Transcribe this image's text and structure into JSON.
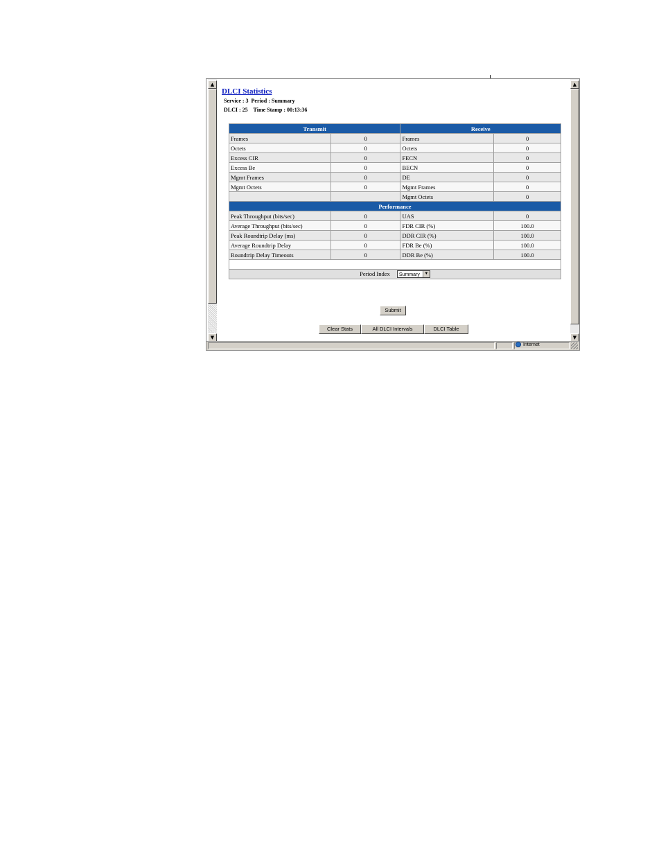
{
  "page": {
    "title": "DLCI Statistics",
    "service_line": "Service : 3  Period : Summary",
    "dlci_line": "DLCI : 25    Time Stamp : 00:13:36"
  },
  "table": {
    "transmit_header": "Transmit",
    "receive_header": "Receive",
    "performance_header": "Performance",
    "counter_rows": [
      {
        "tx_label": "Frames",
        "tx_value": "0",
        "rx_label": "Frames",
        "rx_value": "0"
      },
      {
        "tx_label": "Octets",
        "tx_value": "0",
        "rx_label": "Octets",
        "rx_value": "0"
      },
      {
        "tx_label": "Excess CIR",
        "tx_value": "0",
        "rx_label": "FECN",
        "rx_value": "0"
      },
      {
        "tx_label": "Excess Be",
        "tx_value": "0",
        "rx_label": "BECN",
        "rx_value": "0"
      },
      {
        "tx_label": "Mgmt Frames",
        "tx_value": "0",
        "rx_label": "DE",
        "rx_value": "0"
      },
      {
        "tx_label": "Mgmt Octets",
        "tx_value": "0",
        "rx_label": "Mgmt Frames",
        "rx_value": "0"
      },
      {
        "tx_label": "",
        "tx_value": "",
        "rx_label": "Mgmt Octets",
        "rx_value": "0"
      }
    ],
    "performance_rows": [
      {
        "tx_label": "Peak Throughput (bits/sec)",
        "tx_value": "0",
        "rx_label": "UAS",
        "rx_value": "0"
      },
      {
        "tx_label": "Average Throughput (bits/sec)",
        "tx_value": "0",
        "rx_label": "FDR CIR (%)",
        "rx_value": "100.0"
      },
      {
        "tx_label": "Peak Roundtrip  Delay (ms)",
        "tx_value": "0",
        "rx_label": "DDR CIR (%)",
        "rx_value": "100.0"
      },
      {
        "tx_label": "Average Roundtrip Delay",
        "tx_value": "0",
        "rx_label": "FDR Be (%)",
        "rx_value": "100.0"
      },
      {
        "tx_label": "Roundtrip Delay Timeouts",
        "tx_value": "0",
        "rx_label": "DDR Be (%)",
        "rx_value": "100.0"
      }
    ],
    "period_index_label": "Period Index",
    "period_index_value": "Summary"
  },
  "buttons": {
    "submit": "Submit",
    "clear_stats": "Clear Stats",
    "all_intervals": "All DLCI Intervals",
    "dlci_table": "DLCI Table"
  },
  "status": {
    "zone": "Internet"
  },
  "icons": {
    "scroll_up": "scroll-up-icon",
    "scroll_down": "scroll-down-icon",
    "dropdown": "chevron-down-icon",
    "zone": "globe-icon"
  },
  "colors": {
    "header_bg": "#1a5aa6",
    "link": "#1020c0"
  }
}
